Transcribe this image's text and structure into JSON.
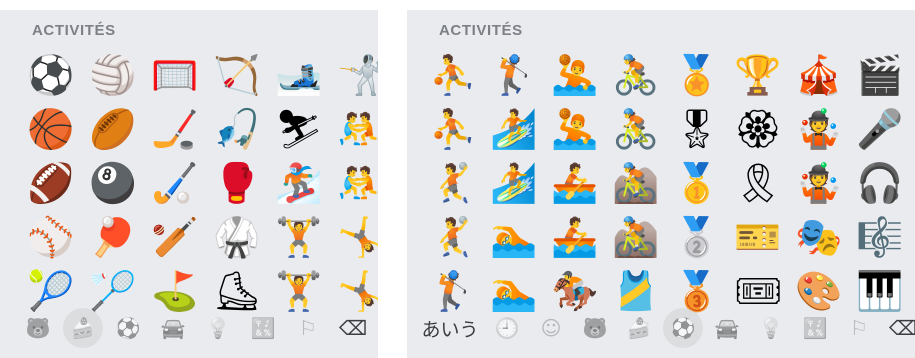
{
  "left_panel": {
    "section_title": "ACTIVITÉS",
    "emojis": [
      "⚽",
      "🏀",
      "🏈",
      "⚾",
      "🎾",
      "🏐",
      "🏉",
      "🎱",
      "🏓",
      "🏸",
      "🥅",
      "🏒",
      "🏑",
      "🏏",
      "⛳",
      "🏹",
      "🎣",
      "🥊",
      "🥋",
      "⛸",
      "🎿",
      "⛷",
      "🏂",
      "🏋",
      "🏋",
      "🤺",
      "🤼",
      "🤼",
      "🤸",
      "🤸"
    ],
    "bar": [
      {
        "name": "smileys-animals-category-icon",
        "glyph": "🐻"
      },
      {
        "name": "food-drink-category-icon",
        "glyph": "🍰",
        "selected": true
      },
      {
        "name": "activity-category-icon",
        "glyph": "⚽"
      },
      {
        "name": "travel-places-category-icon",
        "glyph": "🚘"
      },
      {
        "name": "objects-category-icon",
        "glyph": "💡"
      },
      {
        "name": "symbols-category-icon",
        "glyph": "🔣"
      },
      {
        "name": "flags-category-icon",
        "glyph": "⚐"
      },
      {
        "name": "delete-key-icon",
        "glyph": "⌫"
      }
    ]
  },
  "right_panel": {
    "section_title": "ACTIVITÉS",
    "emojis": [
      "⛹",
      "⛹",
      "🤾",
      "🤾",
      "🏌",
      "🏌",
      "🏄",
      "🏄",
      "🏊",
      "🏊",
      "🤽",
      "🤽",
      "🚣",
      "🚣",
      "🏇",
      "🚴",
      "🚴",
      "🚵",
      "🚵",
      "🎽",
      "🏅",
      "🎖",
      "🥇",
      "🥈",
      "🥉",
      "🏆",
      "🏵",
      "🎗",
      "🎫",
      "🎟",
      "🎪",
      "🤹",
      "🤹",
      "🎭",
      "🎨",
      "🎬",
      "🎤",
      "🎧",
      "🎼",
      "🎹"
    ],
    "keyboard_switch_label": "あいう",
    "bar": [
      {
        "name": "recent-category-icon",
        "glyph": "🕘"
      },
      {
        "name": "smileys-category-icon",
        "glyph": "☺"
      },
      {
        "name": "animals-category-icon",
        "glyph": "🐻"
      },
      {
        "name": "food-drink-category-icon",
        "glyph": "🍰"
      },
      {
        "name": "activity-category-icon",
        "glyph": "⚽",
        "selected": true
      },
      {
        "name": "travel-places-category-icon",
        "glyph": "🚘"
      },
      {
        "name": "objects-category-icon",
        "glyph": "💡"
      },
      {
        "name": "symbols-category-icon",
        "glyph": "🔣"
      },
      {
        "name": "flags-category-icon",
        "glyph": "⚐"
      },
      {
        "name": "delete-key-icon",
        "glyph": "⌫"
      }
    ]
  }
}
